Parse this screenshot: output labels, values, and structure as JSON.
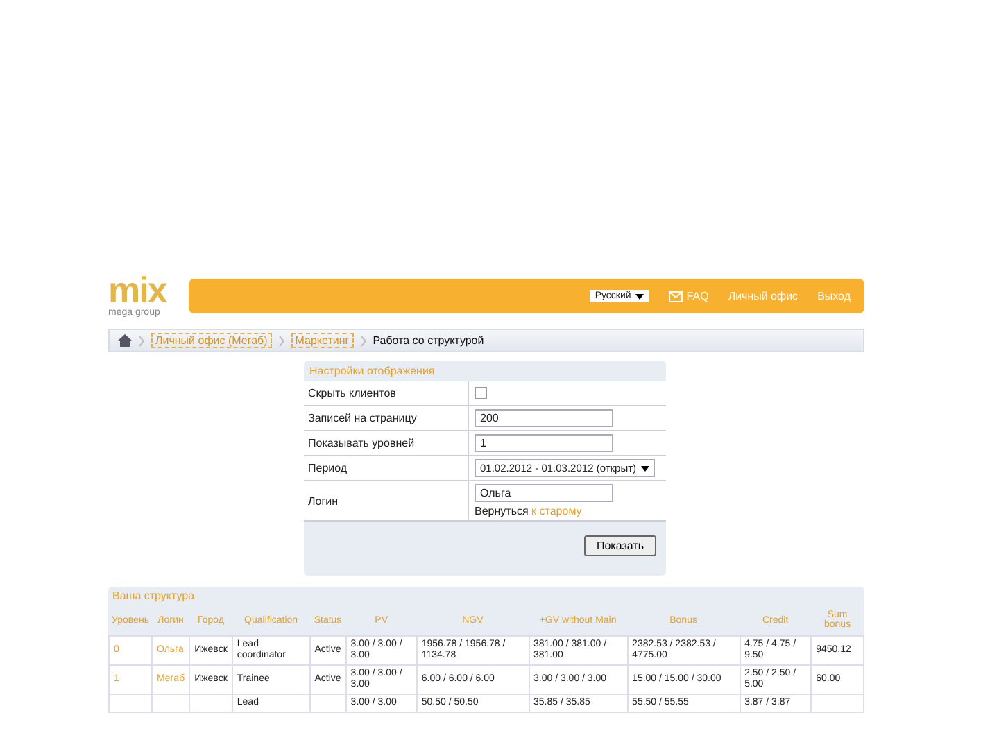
{
  "logo": {
    "name": "mix",
    "tagline": "mega group"
  },
  "top_nav": {
    "language": "Русский",
    "items": [
      {
        "label": "FAQ",
        "icon": true
      },
      {
        "label": "Личный офис",
        "icon": false
      },
      {
        "label": "Выход",
        "icon": false
      }
    ]
  },
  "breadcrumb": [
    {
      "label": "Личный офис (Мегаб)",
      "kind": "link"
    },
    {
      "label": "Маркетинг",
      "kind": "link"
    },
    {
      "label": "Работа со структурой",
      "kind": "current"
    }
  ],
  "settings": {
    "title": "Настройки отображения",
    "rows": [
      {
        "label": "Скрыть клиентов",
        "kind": "checkbox",
        "checked": false
      },
      {
        "label": "Записей на страницу",
        "kind": "input",
        "value": "200"
      },
      {
        "label": "Показывать уровней",
        "kind": "input",
        "value": "1"
      },
      {
        "label": "Период",
        "kind": "select",
        "value": "01.02.2012 - 01.03.2012 (открыт)"
      },
      {
        "label": "Логин",
        "kind": "login",
        "value": "Ольга",
        "note": "Вернуться ",
        "link": "к старому"
      }
    ],
    "button": "Показать"
  },
  "structure": {
    "title": "Ваша структура",
    "columns": [
      "Уровень",
      "Логин",
      "Город",
      "Qualification",
      "Status",
      "PV",
      "NGV",
      "+GV without Main",
      "Bonus",
      "Credit",
      "Sum bonus"
    ],
    "rows": [
      {
        "cells": [
          "0",
          "Ольга",
          "Ижевск",
          "Lead coordinator",
          "Active",
          "3.00 / 3.00 / 3.00",
          "1956.78 / 1956.78 / 1134.78",
          "381.00 / 381.00 / 381.00",
          "2382.53 / 2382.53 / 4775.00",
          "4.75 / 4.75 / 9.50",
          "9450.12"
        ]
      },
      {
        "cells": [
          "1",
          "Мегаб",
          "Ижевск",
          "Trainee",
          "Active",
          "3.00 / 3.00 / 3.00",
          "6.00 / 6.00 / 6.00",
          "3.00 / 3.00 / 3.00",
          "15.00 / 15.00 / 30.00",
          "2.50 / 2.50 / 5.00",
          "60.00"
        ]
      },
      {
        "cells": [
          "",
          "",
          "",
          "Lead",
          "",
          "3.00 / 3.00",
          "50.50 / 50.50",
          "35.85 / 35.85",
          "55.50 / 55.55",
          "3.87 / 3.87",
          ""
        ]
      }
    ]
  }
}
